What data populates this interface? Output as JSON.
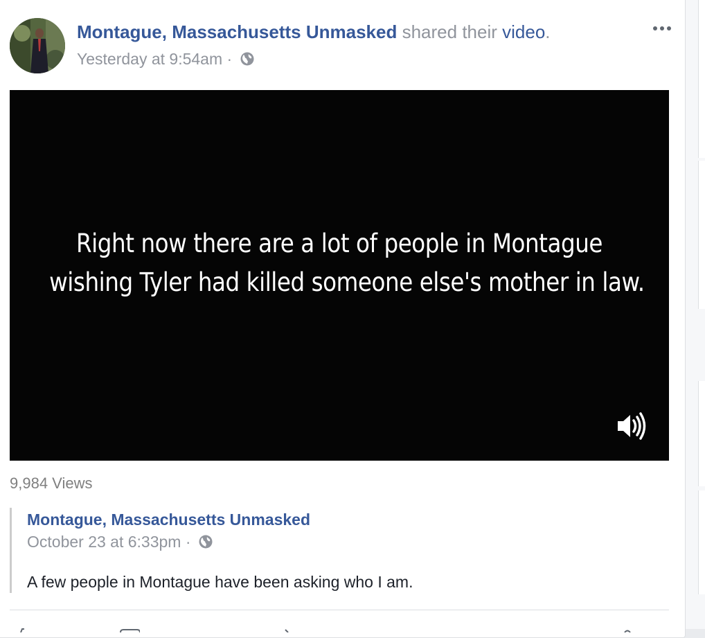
{
  "post": {
    "author": "Montague, Massachusetts Unmasked",
    "shared_text": "shared their",
    "video_link": "video",
    "period": ".",
    "timestamp": "Yesterday at 9:54am",
    "separator": "·",
    "audience_icon": "globe-icon",
    "more_icon": "more-horizontal-icon"
  },
  "video": {
    "caption_line1": "Right now there are a lot of people in Montague",
    "caption_line2": "wishing Tyler had killed someone else's mother in law.",
    "volume_icon": "volume-icon",
    "views": "9,984 Views"
  },
  "original_post": {
    "author": "Montague, Massachusetts Unmasked",
    "timestamp": "October 23 at 6:33pm",
    "separator": "·",
    "audience_icon": "globe-icon",
    "text": "A few people in Montague have been asking who I am."
  },
  "colors": {
    "link": "#365899",
    "meta": "#90949c",
    "text": "#1d2129",
    "video_bg": "#050505"
  }
}
